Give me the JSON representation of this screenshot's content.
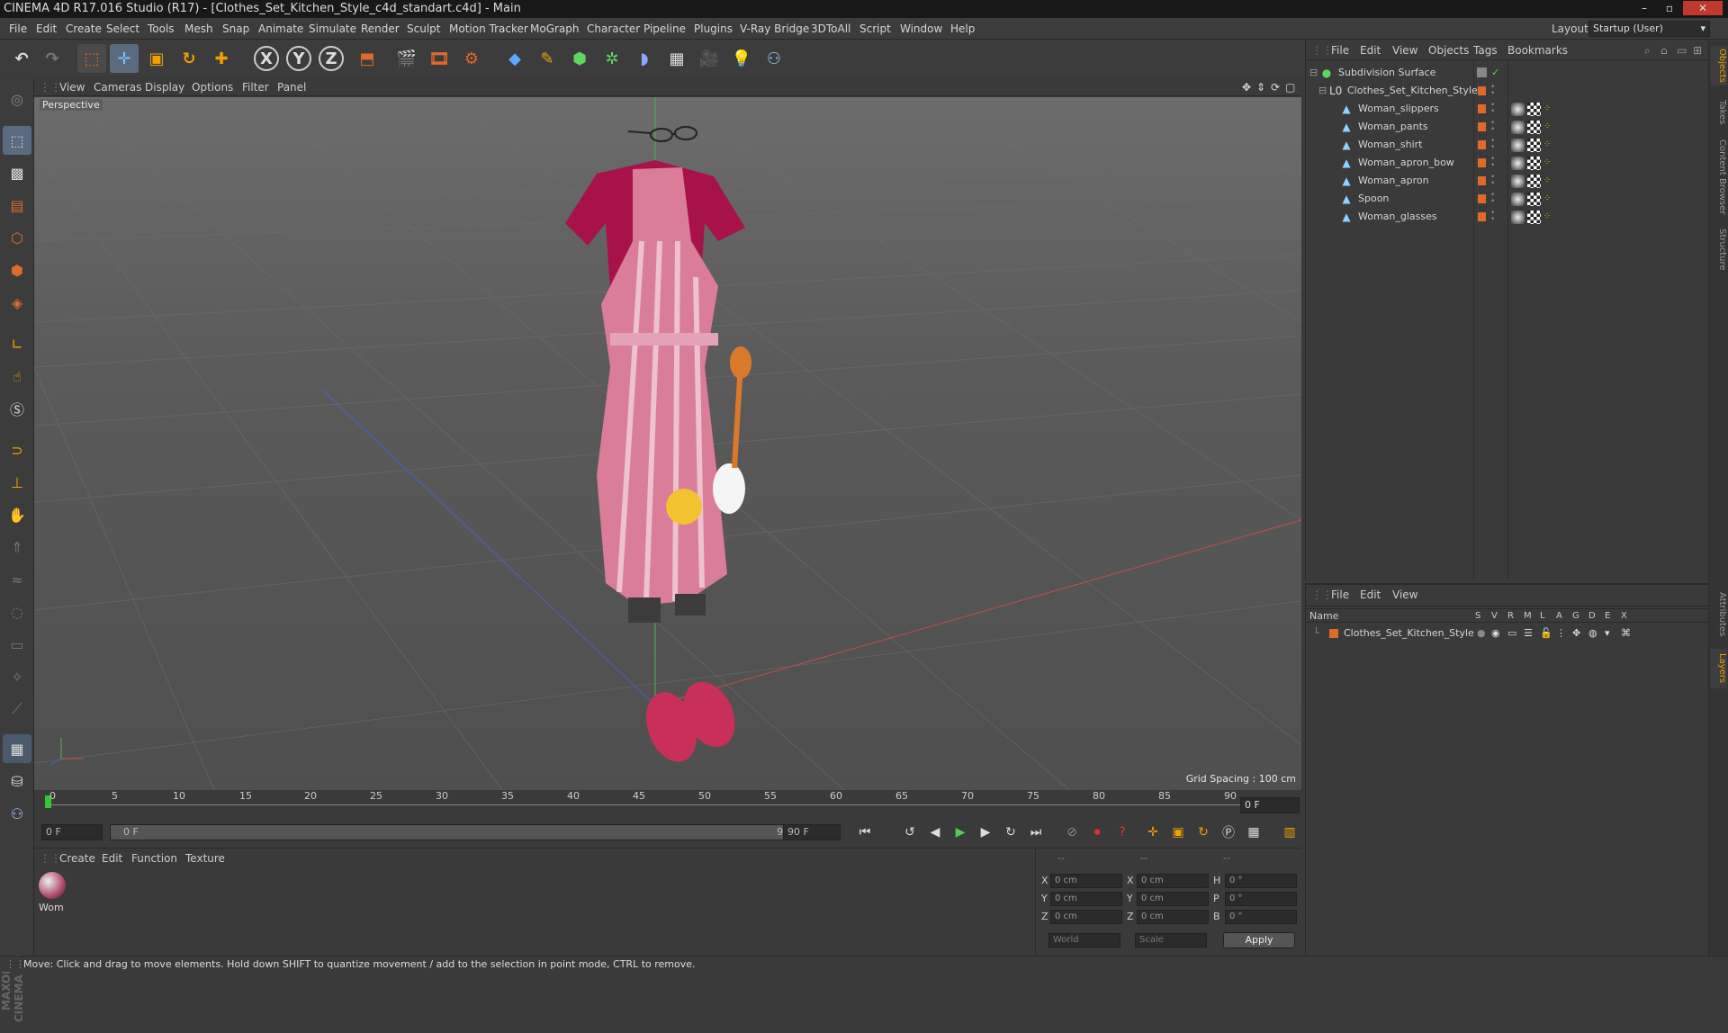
{
  "window": {
    "title": "CINEMA 4D R17.016 Studio (R17) - [Clothes_Set_Kitchen_Style_c4d_standart.c4d] - Main",
    "minimize": "–",
    "maximize": "▫",
    "close": "✕"
  },
  "menubar": {
    "items": [
      "File",
      "Edit",
      "Create",
      "Select",
      "Tools",
      "Mesh",
      "Snap",
      "Animate",
      "Simulate",
      "Render",
      "Sculpt",
      "Motion Tracker",
      "MoGraph",
      "Character",
      "Pipeline",
      "Plugins",
      "V-Ray Bridge",
      "3DToAll",
      "Script",
      "Window",
      "Help"
    ],
    "layout_label": "Layout:",
    "layout_value": "Startup (User)"
  },
  "viewport": {
    "menu": [
      "View",
      "Cameras",
      "Display",
      "Options",
      "Filter",
      "Panel"
    ],
    "label": "Perspective",
    "grid_spacing": "Grid Spacing : 100 cm"
  },
  "timeline": {
    "ticks": [
      "0",
      "5",
      "10",
      "15",
      "20",
      "25",
      "30",
      "35",
      "40",
      "45",
      "50",
      "55",
      "60",
      "65",
      "70",
      "75",
      "80",
      "85",
      "90"
    ],
    "current_frame": "0 F"
  },
  "playback": {
    "start_field": "0 F",
    "range_start": "0 F",
    "range_end": "90 F",
    "end_field": "90 F"
  },
  "material_panel": {
    "menu": [
      "Create",
      "Edit",
      "Function",
      "Texture"
    ],
    "material_name": "Wom"
  },
  "coord_panel": {
    "headers": [
      "--",
      "--",
      "--"
    ],
    "rows": [
      {
        "a_lbl": "X",
        "a": "0 cm",
        "b_lbl": "X",
        "b": "0 cm",
        "c_lbl": "H",
        "c": "0 °"
      },
      {
        "a_lbl": "Y",
        "a": "0 cm",
        "b_lbl": "Y",
        "b": "0 cm",
        "c_lbl": "P",
        "c": "0 °"
      },
      {
        "a_lbl": "Z",
        "a": "0 cm",
        "b_lbl": "Z",
        "b": "0 cm",
        "c_lbl": "B",
        "c": "0 °"
      }
    ],
    "mode": "World",
    "type": "Scale",
    "apply": "Apply"
  },
  "object_manager": {
    "menu": [
      "File",
      "Edit",
      "View",
      "Objects",
      "Tags",
      "Bookmarks"
    ],
    "objects": [
      {
        "name": "Subdivision Surface",
        "level": 0
      },
      {
        "name": "Clothes_Set_Kitchen_Style",
        "level": 1
      },
      {
        "name": "Woman_slippers",
        "level": 2
      },
      {
        "name": "Woman_pants",
        "level": 2
      },
      {
        "name": "Woman_shirt",
        "level": 2
      },
      {
        "name": "Woman_apron_bow",
        "level": 2
      },
      {
        "name": "Woman_apron",
        "level": 2
      },
      {
        "name": "Spoon",
        "level": 2
      },
      {
        "name": "Woman_glasses",
        "level": 2
      }
    ]
  },
  "layer_manager": {
    "menu": [
      "File",
      "Edit",
      "View"
    ],
    "columns": [
      "Name",
      "S",
      "V",
      "R",
      "M",
      "L",
      "A",
      "G",
      "D",
      "E",
      "X"
    ],
    "layers": [
      "Clothes_Set_Kitchen_Style"
    ]
  },
  "right_tabs": [
    "Objects",
    "Takes",
    "Content Browser",
    "Structure",
    "Attributes",
    "Layers"
  ],
  "status": "Move: Click and drag to move elements. Hold down SHIFT to quantize movement / add to the selection in point mode, CTRL to remove.",
  "colors": {
    "accent": "#e06a2a",
    "x_axis": "#c94b4b",
    "y_axis": "#4fb04f",
    "z_axis": "#4b5fc9"
  }
}
